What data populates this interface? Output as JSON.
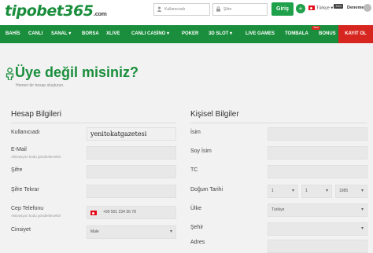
{
  "header": {
    "logo_main": "tipobet365",
    "logo_suffix": ".com",
    "username_placeholder": "Kullanıcıadı",
    "password_placeholder": "Şifre",
    "login_label": "Giriş",
    "plus_label": "+",
    "language": "Türkçe",
    "support_badge": "7/24",
    "demo_label": "Deneme"
  },
  "nav": {
    "items": [
      "BAHİS",
      "CANLI",
      "SANAL",
      "BORSA",
      "XLIVE",
      "CANLI CASİNO",
      "POKER",
      "3D SLOT",
      "LIVE GAMES",
      "TOMBALA",
      "BONUS",
      "KAYIT OL"
    ],
    "new_badge": "Yeni"
  },
  "page": {
    "title": "Üye değil misiniz?",
    "subtitle": "Hemen bir hesap oluşturun."
  },
  "account": {
    "section_title": "Hesap Bilgileri",
    "username_label": "Kullanıcıadı",
    "username_value": "yenitokatgazetesi",
    "email_label": "E-Mail",
    "email_hint": "Aktivasyon kodu gönderilecektir",
    "password_label": "Şifre",
    "password_repeat_label": "Şifre Tekrar",
    "phone_label": "Cep Telefonu",
    "phone_hint": "Aktivasyon kodu gönderilecektir",
    "phone_value": "+90 501 234 56 78",
    "gender_label": "Cinsiyet",
    "gender_value": "Male"
  },
  "personal": {
    "section_title": "Kişisel Bilgiler",
    "name_label": "İsim",
    "surname_label": "Soy İsim",
    "tc_label": "TC",
    "birth_label": "Doğum Tarihi",
    "birth_day": "1",
    "birth_month": "1",
    "birth_year": "1985",
    "country_label": "Ülke",
    "country_value": "Türkiye",
    "city_label": "Şehir",
    "address_label": "Adres"
  },
  "colors": {
    "brand_green": "#1a8e3c",
    "signup_red": "#d7261f"
  }
}
